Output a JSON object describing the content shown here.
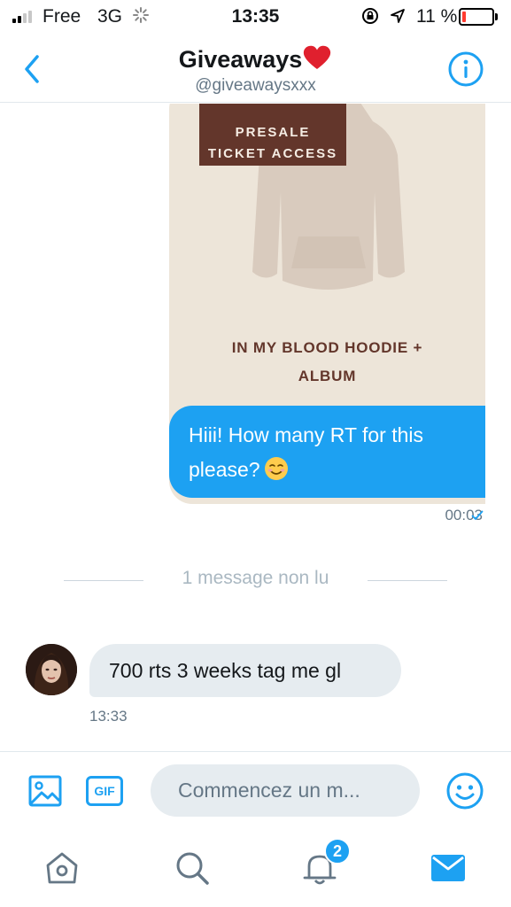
{
  "status_bar": {
    "carrier": "Free",
    "network": "3G",
    "time": "13:35",
    "battery_percent": "11 %",
    "battery_level": 0.11,
    "battery_color": "#ff3b30"
  },
  "header": {
    "title": "Giveaways",
    "title_emoji": "heart-icon",
    "handle": "@giveawaysxxx",
    "accent_color": "#1da1f2"
  },
  "conversation": {
    "product_card": {
      "badge_line1": "PRESALE",
      "badge_line2": "TICKET ACCESS",
      "title_line1": "IN MY BLOOD HOODIE +",
      "title_line2": "ALBUM"
    },
    "outgoing_message": {
      "text": "Hiii! How many RT for this please?",
      "emoji": "smiling-face-icon",
      "time": "00:03"
    },
    "unread_divider": "1 message non lu",
    "incoming_message": {
      "text": "700 rts 3 weeks tag me gl",
      "time": "13:33"
    }
  },
  "composer": {
    "gif_label": "GIF",
    "placeholder": "Commencez un m..."
  },
  "tab_bar": {
    "items": [
      "home-icon",
      "search-icon",
      "notifications-icon",
      "messages-icon"
    ],
    "notification_count": "2",
    "active": "messages-icon"
  }
}
